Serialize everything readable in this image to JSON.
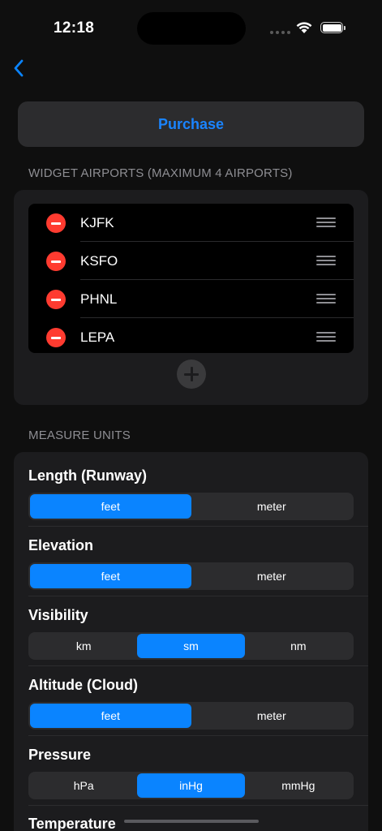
{
  "status": {
    "time": "12:18"
  },
  "purchase": {
    "label": "Purchase"
  },
  "widget_airports": {
    "header": "WIDGET AIRPORTS (MAXIMUM 4 AIRPORTS)",
    "airports": [
      "KJFK",
      "KSFO",
      "PHNL",
      "LEPA"
    ]
  },
  "measure_units": {
    "header": "MEASURE UNITS",
    "groups": [
      {
        "label": "Length (Runway)",
        "options": [
          "feet",
          "meter"
        ],
        "selected": "feet"
      },
      {
        "label": "Elevation",
        "options": [
          "feet",
          "meter"
        ],
        "selected": "feet"
      },
      {
        "label": "Visibility",
        "options": [
          "km",
          "sm",
          "nm"
        ],
        "selected": "sm"
      },
      {
        "label": "Altitude (Cloud)",
        "options": [
          "feet",
          "meter"
        ],
        "selected": "feet"
      },
      {
        "label": "Pressure",
        "options": [
          "hPa",
          "inHg",
          "mmHg"
        ],
        "selected": "inHg"
      },
      {
        "label": "Temperature",
        "options": [],
        "selected": ""
      }
    ]
  },
  "colors": {
    "accent": "#0a84ff",
    "link": "#1a84ff",
    "destructive": "#ff3b30",
    "background": "#0f0f0f",
    "card": "#1c1c1e"
  },
  "icons": {
    "back": "chevron-left-icon",
    "wifi": "wifi-icon",
    "battery": "battery-icon",
    "remove": "minus-circle-icon",
    "reorder": "reorder-handle-icon",
    "add": "plus-circle-icon"
  }
}
